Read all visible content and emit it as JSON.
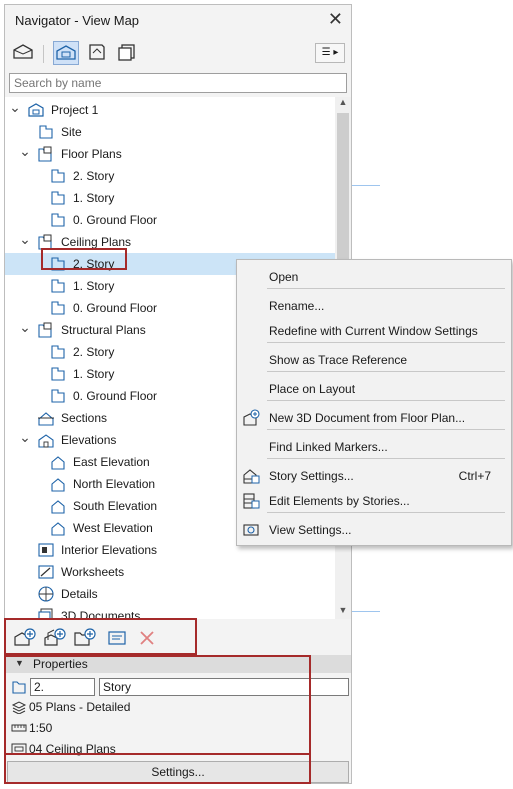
{
  "window": {
    "title": "Navigator - View Map",
    "close_icon": "✕"
  },
  "view_buttons": [
    "project-map-icon",
    "view-map-icon",
    "layout-book-icon",
    "publisher-sets-icon"
  ],
  "search": {
    "placeholder": "Search by name",
    "value": ""
  },
  "tree": [
    {
      "label": "Project 1",
      "icon": "project-icon",
      "level": 0,
      "expanded": true
    },
    {
      "label": "Site",
      "icon": "floor-plan-view-icon",
      "level": 1
    },
    {
      "label": "Floor Plans",
      "icon": "floor-plans-folder-icon",
      "level": 1,
      "expanded": true
    },
    {
      "label": "2. Story",
      "icon": "floor-plan-view-icon",
      "level": 2
    },
    {
      "label": "1. Story",
      "icon": "floor-plan-view-icon",
      "level": 2
    },
    {
      "label": "0. Ground Floor",
      "icon": "floor-plan-view-icon",
      "level": 2
    },
    {
      "label": "Ceiling Plans",
      "icon": "ceiling-plans-folder-icon",
      "level": 1,
      "expanded": true
    },
    {
      "label": "2. Story",
      "icon": "ceiling-plan-view-icon",
      "level": 2,
      "selected": true
    },
    {
      "label": "1. Story",
      "icon": "ceiling-plan-view-icon",
      "level": 2
    },
    {
      "label": "0. Ground Floor",
      "icon": "ceiling-plan-view-icon",
      "level": 2
    },
    {
      "label": "Structural Plans",
      "icon": "structural-plans-folder-icon",
      "level": 1,
      "expanded": true
    },
    {
      "label": "2. Story",
      "icon": "structural-plan-view-icon",
      "level": 2
    },
    {
      "label": "1. Story",
      "icon": "structural-plan-view-icon",
      "level": 2
    },
    {
      "label": "0. Ground Floor",
      "icon": "structural-plan-view-icon",
      "level": 2
    },
    {
      "label": "Sections",
      "icon": "sections-icon",
      "level": 1
    },
    {
      "label": "Elevations",
      "icon": "elevations-icon",
      "level": 1,
      "expanded": true
    },
    {
      "label": "East Elevation",
      "icon": "elevation-view-icon",
      "level": 2
    },
    {
      "label": "North Elevation",
      "icon": "elevation-view-icon",
      "level": 2
    },
    {
      "label": "South Elevation",
      "icon": "elevation-view-icon",
      "level": 2
    },
    {
      "label": "West Elevation",
      "icon": "elevation-view-icon",
      "level": 2
    },
    {
      "label": "Interior Elevations",
      "icon": "interior-elevations-icon",
      "level": 1
    },
    {
      "label": "Worksheets",
      "icon": "worksheets-icon",
      "level": 1
    },
    {
      "label": "Details",
      "icon": "details-icon",
      "level": 1
    },
    {
      "label": "3D Documents",
      "icon": "3d-documents-icon",
      "level": 1
    }
  ],
  "action_buttons": [
    "save-current-view-icon",
    "clone-view-icon",
    "new-folder-icon",
    "view-settings-icon",
    "delete-icon"
  ],
  "properties": {
    "header": "Properties",
    "id_value": "2.",
    "name_value": "Story",
    "layer_combination": "05 Plans - Detailed",
    "scale": "1:50",
    "layout_set": "04 Ceiling Plans",
    "settings_button": "Settings..."
  },
  "context_menu": {
    "items": [
      {
        "label": "Open",
        "icon": ""
      },
      {
        "label": "Rename...",
        "icon": ""
      },
      {
        "label": "Redefine with Current Window Settings",
        "icon": ""
      },
      {
        "label": "Show as Trace Reference",
        "icon": ""
      },
      {
        "label": "Place on Layout",
        "icon": ""
      },
      {
        "label": "New 3D Document from Floor Plan...",
        "icon": "new-3d-document-icon"
      },
      {
        "label": "Find Linked Markers...",
        "icon": ""
      },
      {
        "label": "Story Settings...",
        "icon": "story-settings-icon",
        "shortcut": "Ctrl+7"
      },
      {
        "label": "Edit Elements by Stories...",
        "icon": "edit-by-stories-icon"
      },
      {
        "label": "View Settings...",
        "icon": "view-settings-icon"
      }
    ]
  },
  "colors": {
    "highlight_box": "#a52a2a",
    "selection": "#cce4f7",
    "icon_blue": "#1e63a8"
  }
}
